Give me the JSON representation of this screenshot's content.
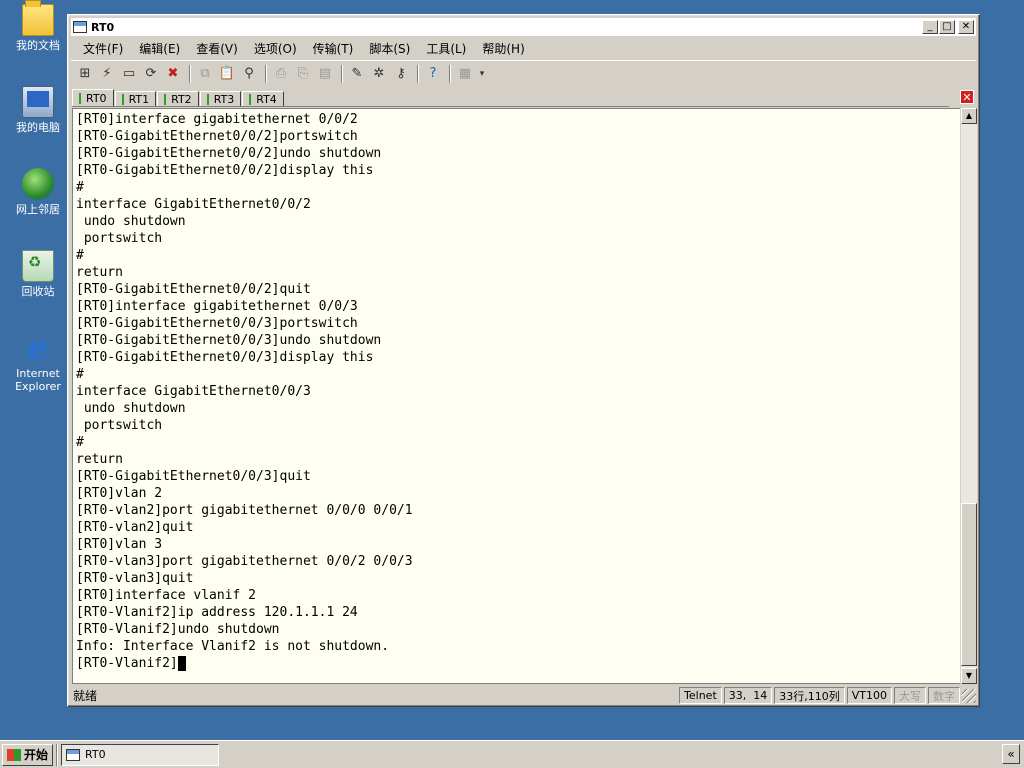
{
  "desktop": {
    "icons": [
      {
        "label": "我的文档",
        "icon": "my-documents-icon"
      },
      {
        "label": "我的电脑",
        "icon": "my-computer-icon"
      },
      {
        "label": "网上邻居",
        "icon": "network-places-icon"
      },
      {
        "label": "回收站",
        "icon": "recycle-bin-icon"
      },
      {
        "label": "Internet Explorer",
        "icon": "internet-explorer-icon"
      }
    ]
  },
  "window": {
    "title": "RT0",
    "menu": [
      "文件(F)",
      "编辑(E)",
      "查看(V)",
      "选项(O)",
      "传输(T)",
      "脚本(S)",
      "工具(L)",
      "帮助(H)"
    ],
    "tabs": [
      "RT0",
      "RT1",
      "RT2",
      "RT3",
      "RT4"
    ],
    "active_tab": "RT0",
    "terminal_lines": [
      "[RT0]interface gigabitethernet 0/0/2",
      "[RT0-GigabitEthernet0/0/2]portswitch",
      "[RT0-GigabitEthernet0/0/2]undo shutdown",
      "[RT0-GigabitEthernet0/0/2]display this",
      "#",
      "interface GigabitEthernet0/0/2",
      " undo shutdown",
      " portswitch",
      "#",
      "return",
      "[RT0-GigabitEthernet0/0/2]quit",
      "[RT0]interface gigabitethernet 0/0/3",
      "[RT0-GigabitEthernet0/0/3]portswitch",
      "[RT0-GigabitEthernet0/0/3]undo shutdown",
      "[RT0-GigabitEthernet0/0/3]display this",
      "#",
      "interface GigabitEthernet0/0/3",
      " undo shutdown",
      " portswitch",
      "#",
      "return",
      "[RT0-GigabitEthernet0/0/3]quit",
      "[RT0]vlan 2",
      "[RT0-vlan2]port gigabitethernet 0/0/0 0/0/1",
      "[RT0-vlan2]quit",
      "[RT0]vlan 3",
      "[RT0-vlan3]port gigabitethernet 0/0/2 0/0/3",
      "[RT0-vlan3]quit",
      "[RT0]interface vlanif 2",
      "[RT0-Vlanif2]ip address 120.1.1.1 24",
      "[RT0-Vlanif2]undo shutdown",
      "Info: Interface Vlanif2 is not shutdown."
    ],
    "prompt": "[RT0-Vlanif2]",
    "status": {
      "ready": "就绪",
      "protocol": "Telnet",
      "position": "33,  14",
      "size": "33行,110列",
      "emulation": "VT100",
      "caps": "大写",
      "num": "数字"
    }
  },
  "taskbar": {
    "start_label": "开始",
    "task_label": "RT0",
    "tray_label": "«"
  }
}
